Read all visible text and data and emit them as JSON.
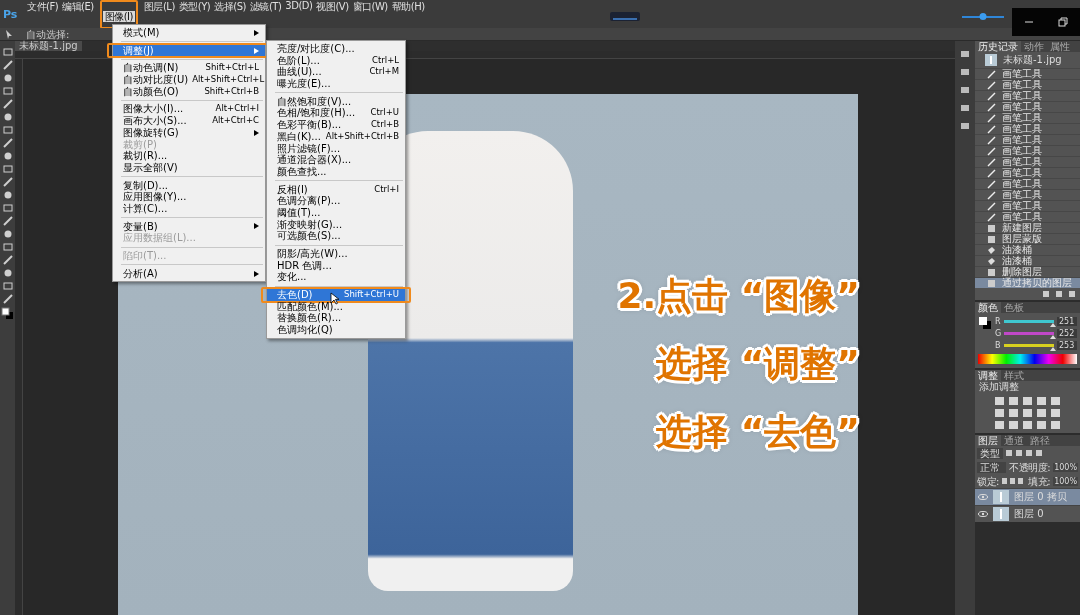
{
  "app": {
    "logo": "Ps"
  },
  "menubar": [
    {
      "label": "文件(F)",
      "selected": false,
      "outlined": false
    },
    {
      "label": "编辑(E)",
      "selected": false,
      "outlined": false
    },
    {
      "label": "图像(I)",
      "selected": true,
      "outlined": true
    },
    {
      "label": "图层(L)",
      "selected": false,
      "outlined": false
    },
    {
      "label": "类型(Y)",
      "selected": false,
      "outlined": false
    },
    {
      "label": "选择(S)",
      "selected": false,
      "outlined": false
    },
    {
      "label": "滤镜(T)",
      "selected": false,
      "outlined": false
    },
    {
      "label": "3D(D)",
      "selected": false,
      "outlined": false
    },
    {
      "label": "视图(V)",
      "selected": false,
      "outlined": false
    },
    {
      "label": "窗口(W)",
      "selected": false,
      "outlined": false
    },
    {
      "label": "帮助(H)",
      "selected": false,
      "outlined": false
    }
  ],
  "top_slider": {
    "level": 0.5
  },
  "options_bar": {
    "label": "自动选择:"
  },
  "document_tab": {
    "title": "未标题-1.jpg"
  },
  "image_menu": [
    {
      "kind": "item",
      "label": "模式(M)",
      "submenu": true,
      "disabled": false,
      "selected": false,
      "outlined": false
    },
    {
      "kind": "separator"
    },
    {
      "kind": "item",
      "label": "调整(J)",
      "submenu": true,
      "disabled": false,
      "selected": true,
      "outlined": true
    },
    {
      "kind": "separator"
    },
    {
      "kind": "item",
      "label": "自动色调(N)",
      "shortcut": "Shift+Ctrl+L",
      "submenu": false,
      "disabled": false,
      "selected": false,
      "outlined": false
    },
    {
      "kind": "item",
      "label": "自动对比度(U)",
      "shortcut": "Alt+Shift+Ctrl+L",
      "submenu": false,
      "disabled": false,
      "selected": false,
      "outlined": false
    },
    {
      "kind": "item",
      "label": "自动颜色(O)",
      "shortcut": "Shift+Ctrl+B",
      "submenu": false,
      "disabled": false,
      "selected": false,
      "outlined": false
    },
    {
      "kind": "separator"
    },
    {
      "kind": "item",
      "label": "图像大小(I)...",
      "shortcut": "Alt+Ctrl+I",
      "submenu": false,
      "disabled": false,
      "selected": false,
      "outlined": false
    },
    {
      "kind": "item",
      "label": "画布大小(S)...",
      "shortcut": "Alt+Ctrl+C",
      "submenu": false,
      "disabled": false,
      "selected": false,
      "outlined": false
    },
    {
      "kind": "item",
      "label": "图像旋转(G)",
      "submenu": true,
      "disabled": false,
      "selected": false,
      "outlined": false
    },
    {
      "kind": "item",
      "label": "裁剪(P)",
      "submenu": false,
      "disabled": true,
      "selected": false,
      "outlined": false
    },
    {
      "kind": "item",
      "label": "裁切(R)...",
      "submenu": false,
      "disabled": false,
      "selected": false,
      "outlined": false
    },
    {
      "kind": "item",
      "label": "显示全部(V)",
      "submenu": false,
      "disabled": false,
      "selected": false,
      "outlined": false
    },
    {
      "kind": "separator"
    },
    {
      "kind": "item",
      "label": "复制(D)...",
      "submenu": false,
      "disabled": false,
      "selected": false,
      "outlined": false
    },
    {
      "kind": "item",
      "label": "应用图像(Y)...",
      "submenu": false,
      "disabled": false,
      "selected": false,
      "outlined": false
    },
    {
      "kind": "item",
      "label": "计算(C)...",
      "submenu": false,
      "disabled": false,
      "selected": false,
      "outlined": false
    },
    {
      "kind": "separator"
    },
    {
      "kind": "item",
      "label": "变量(B)",
      "submenu": true,
      "disabled": false,
      "selected": false,
      "outlined": false
    },
    {
      "kind": "item",
      "label": "应用数据组(L)...",
      "submenu": false,
      "disabled": true,
      "selected": false,
      "outlined": false
    },
    {
      "kind": "separator"
    },
    {
      "kind": "item",
      "label": "陷印(T)...",
      "submenu": false,
      "disabled": true,
      "selected": false,
      "outlined": false
    },
    {
      "kind": "separator"
    },
    {
      "kind": "item",
      "label": "分析(A)",
      "submenu": true,
      "disabled": false,
      "selected": false,
      "outlined": false
    }
  ],
  "adjust_menu": [
    {
      "kind": "item",
      "label": "亮度/对比度(C)...",
      "disabled": false,
      "selected": false,
      "outlined": false
    },
    {
      "kind": "item",
      "label": "色阶(L)...",
      "shortcut": "Ctrl+L",
      "disabled": false,
      "selected": false,
      "outlined": false
    },
    {
      "kind": "item",
      "label": "曲线(U)...",
      "shortcut": "Ctrl+M",
      "disabled": false,
      "selected": false,
      "outlined": false
    },
    {
      "kind": "item",
      "label": "曝光度(E)...",
      "disabled": false,
      "selected": false,
      "outlined": false
    },
    {
      "kind": "separator"
    },
    {
      "kind": "item",
      "label": "自然饱和度(V)...",
      "disabled": false,
      "selected": false,
      "outlined": false
    },
    {
      "kind": "item",
      "label": "色相/饱和度(H)...",
      "shortcut": "Ctrl+U",
      "disabled": false,
      "selected": false,
      "outlined": false
    },
    {
      "kind": "item",
      "label": "色彩平衡(B)...",
      "shortcut": "Ctrl+B",
      "disabled": false,
      "selected": false,
      "outlined": false
    },
    {
      "kind": "item",
      "label": "黑白(K)...",
      "shortcut": "Alt+Shift+Ctrl+B",
      "disabled": false,
      "selected": false,
      "outlined": false
    },
    {
      "kind": "item",
      "label": "照片滤镜(F)...",
      "disabled": false,
      "selected": false,
      "outlined": false
    },
    {
      "kind": "item",
      "label": "通道混合器(X)...",
      "disabled": false,
      "selected": false,
      "outlined": false
    },
    {
      "kind": "item",
      "label": "颜色查找...",
      "disabled": false,
      "selected": false,
      "outlined": false
    },
    {
      "kind": "separator"
    },
    {
      "kind": "item",
      "label": "反相(I)",
      "shortcut": "Ctrl+I",
      "disabled": false,
      "selected": false,
      "outlined": false
    },
    {
      "kind": "item",
      "label": "色调分离(P)...",
      "disabled": false,
      "selected": false,
      "outlined": false
    },
    {
      "kind": "item",
      "label": "阈值(T)...",
      "disabled": false,
      "selected": false,
      "outlined": false
    },
    {
      "kind": "item",
      "label": "渐变映射(G)...",
      "disabled": false,
      "selected": false,
      "outlined": false
    },
    {
      "kind": "item",
      "label": "可选颜色(S)...",
      "disabled": false,
      "selected": false,
      "outlined": false
    },
    {
      "kind": "separator"
    },
    {
      "kind": "item",
      "label": "阴影/高光(W)...",
      "disabled": false,
      "selected": false,
      "outlined": false
    },
    {
      "kind": "item",
      "label": "HDR 色调...",
      "disabled": false,
      "selected": false,
      "outlined": false
    },
    {
      "kind": "item",
      "label": "变化...",
      "disabled": false,
      "selected": false,
      "outlined": false
    },
    {
      "kind": "separator"
    },
    {
      "kind": "item",
      "label": "去色(D)",
      "shortcut": "Shift+Ctrl+U",
      "disabled": false,
      "selected": true,
      "outlined": true
    },
    {
      "kind": "item",
      "label": "匹配颜色(M)...",
      "disabled": false,
      "selected": false,
      "outlined": false
    },
    {
      "kind": "item",
      "label": "替换颜色(R)...",
      "disabled": false,
      "selected": false,
      "outlined": false
    },
    {
      "kind": "item",
      "label": "色调均化(Q)",
      "disabled": false,
      "selected": false,
      "outlined": false
    }
  ],
  "annotation": [
    "2.点击 “图像”",
    "选择 “调整”",
    "选择 “去色”"
  ],
  "history_panel": {
    "tabs": [
      {
        "label": "历史记录",
        "selected": true
      },
      {
        "label": "动作",
        "selected": false
      },
      {
        "label": "属性",
        "selected": false
      }
    ],
    "snapshot": "未标题-1.jpg",
    "items": [
      {
        "kind": "brush",
        "label": "画笔工具",
        "selected": false
      },
      {
        "kind": "brush",
        "label": "画笔工具",
        "selected": false
      },
      {
        "kind": "brush",
        "label": "画笔工具",
        "selected": false
      },
      {
        "kind": "brush",
        "label": "画笔工具",
        "selected": false
      },
      {
        "kind": "brush",
        "label": "画笔工具",
        "selected": false
      },
      {
        "kind": "brush",
        "label": "画笔工具",
        "selected": false
      },
      {
        "kind": "brush",
        "label": "画笔工具",
        "selected": false
      },
      {
        "kind": "brush",
        "label": "画笔工具",
        "selected": false
      },
      {
        "kind": "brush",
        "label": "画笔工具",
        "selected": false
      },
      {
        "kind": "brush",
        "label": "画笔工具",
        "selected": false
      },
      {
        "kind": "brush",
        "label": "画笔工具",
        "selected": false
      },
      {
        "kind": "brush",
        "label": "画笔工具",
        "selected": false
      },
      {
        "kind": "brush",
        "label": "画笔工具",
        "selected": false
      },
      {
        "kind": "brush",
        "label": "画笔工具",
        "selected": false
      },
      {
        "kind": "layer",
        "label": "新建图层",
        "selected": false
      },
      {
        "kind": "layer",
        "label": "图层蒙版",
        "selected": false
      },
      {
        "kind": "bucket",
        "label": "油漆桶",
        "selected": false
      },
      {
        "kind": "bucket",
        "label": "油漆桶",
        "selected": false
      },
      {
        "kind": "layer",
        "label": "删除图层",
        "selected": false
      },
      {
        "kind": "layer",
        "label": "通过拷贝的图层",
        "selected": true
      }
    ]
  },
  "color_panel": {
    "tabs": [
      {
        "label": "颜色",
        "selected": true
      },
      {
        "label": "色板",
        "selected": false
      }
    ],
    "channels": [
      {
        "name": "R",
        "value": "251",
        "level": 0.98,
        "color": "#3fc8d0"
      },
      {
        "name": "G",
        "value": "252",
        "level": 0.98,
        "color": "#c048c8"
      },
      {
        "name": "B",
        "value": "253",
        "level": 0.98,
        "color": "#d8d020"
      }
    ]
  },
  "adjust_panel": {
    "tabs": [
      {
        "label": "调整",
        "selected": true
      },
      {
        "label": "样式",
        "selected": false
      }
    ],
    "hint": "添加调整"
  },
  "layers_panel": {
    "tabs": [
      {
        "label": "图层",
        "selected": true
      },
      {
        "label": "通道",
        "selected": false
      },
      {
        "label": "路径",
        "selected": false
      }
    ],
    "filter": "类型",
    "blend_mode": "正常",
    "opacity_label": "不透明度:",
    "opacity": "100%",
    "lock_label": "锁定:",
    "fill_label": "填充:",
    "fill": "100%",
    "layers": [
      {
        "name": "图层 0 拷贝",
        "selected": true,
        "visible": true
      },
      {
        "name": "图层 0",
        "selected": false,
        "visible": true
      }
    ]
  }
}
